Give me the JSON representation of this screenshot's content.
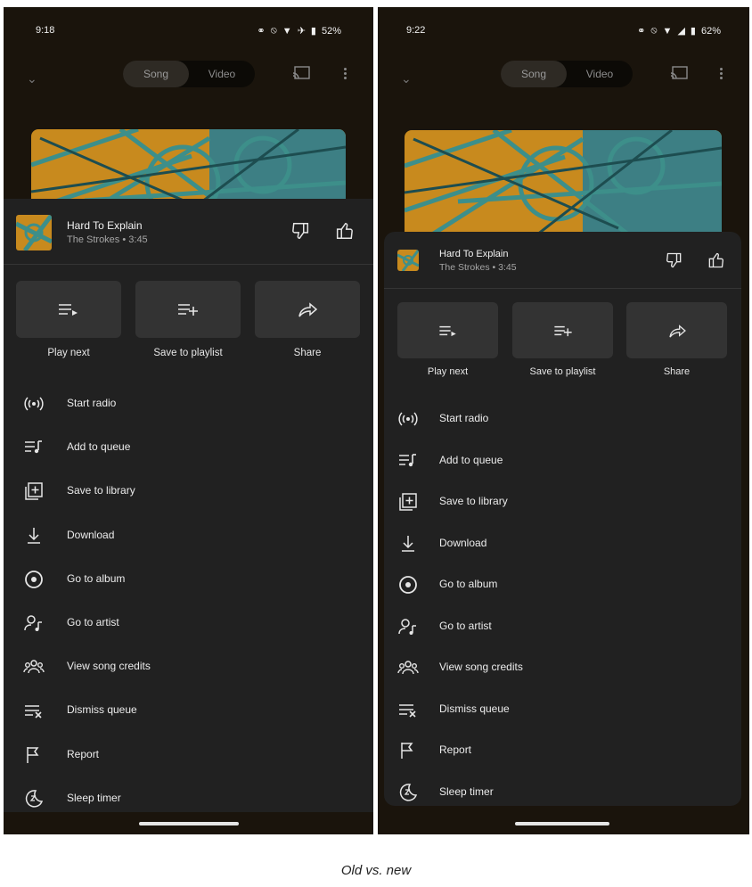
{
  "old": {
    "time": "9:18",
    "battery": "52%",
    "toggle": {
      "song": "Song",
      "video": "Video"
    },
    "song": {
      "title": "Hard To Explain",
      "subtitle": "The Strokes • 3:45"
    },
    "tiles": [
      {
        "label": "Play next",
        "icon": "play-next-icon"
      },
      {
        "label": "Save to playlist",
        "icon": "playlist-add-icon"
      },
      {
        "label": "Share",
        "icon": "share-icon"
      }
    ],
    "menu": [
      {
        "label": "Start radio",
        "icon": "radio-icon"
      },
      {
        "label": "Add to queue",
        "icon": "queue-music-icon"
      },
      {
        "label": "Save to library",
        "icon": "library-add-icon"
      },
      {
        "label": "Download",
        "icon": "download-icon"
      },
      {
        "label": "Go to album",
        "icon": "album-icon"
      },
      {
        "label": "Go to artist",
        "icon": "artist-icon"
      },
      {
        "label": "View song credits",
        "icon": "credits-icon"
      },
      {
        "label": "Dismiss queue",
        "icon": "dismiss-queue-icon"
      },
      {
        "label": "Report",
        "icon": "flag-icon"
      },
      {
        "label": "Sleep timer",
        "icon": "sleep-timer-icon"
      }
    ]
  },
  "new": {
    "time": "9:22",
    "battery": "62%",
    "toggle": {
      "song": "Song",
      "video": "Video"
    },
    "song": {
      "title": "Hard To Explain",
      "subtitle": "The Strokes • 3:45"
    },
    "tiles": [
      {
        "label": "Play next",
        "icon": "play-next-icon"
      },
      {
        "label": "Save to playlist",
        "icon": "playlist-add-icon"
      },
      {
        "label": "Share",
        "icon": "share-icon"
      }
    ],
    "menu": [
      {
        "label": "Start radio",
        "icon": "radio-icon"
      },
      {
        "label": "Add to queue",
        "icon": "queue-music-icon"
      },
      {
        "label": "Save to library",
        "icon": "library-add-icon"
      },
      {
        "label": "Download",
        "icon": "download-icon"
      },
      {
        "label": "Go to album",
        "icon": "album-icon"
      },
      {
        "label": "Go to artist",
        "icon": "artist-icon"
      },
      {
        "label": "View song credits",
        "icon": "credits-icon"
      },
      {
        "label": "Dismiss queue",
        "icon": "dismiss-queue-icon"
      },
      {
        "label": "Report",
        "icon": "flag-icon"
      },
      {
        "label": "Sleep timer",
        "icon": "sleep-timer-icon"
      }
    ]
  },
  "caption": "Old vs. new",
  "colors": {
    "sheet": "#212121",
    "tile": "#333333",
    "backdrop": "#1a140c",
    "art_orange": "#c88a1e",
    "art_teal": "#3d8f8a"
  }
}
